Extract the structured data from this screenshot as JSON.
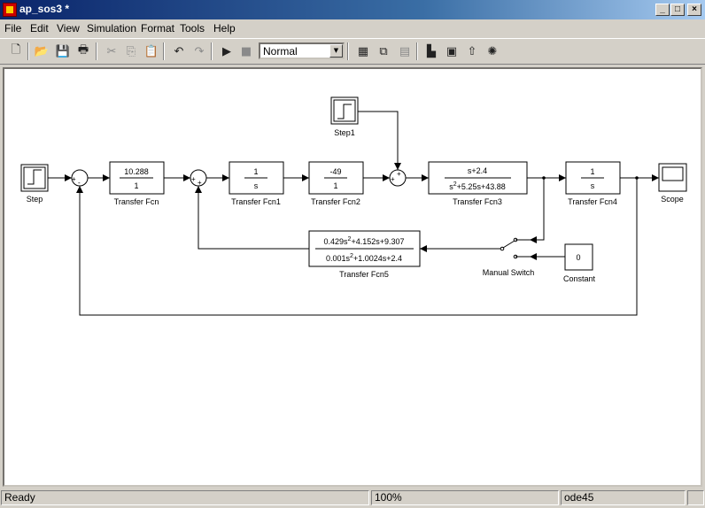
{
  "window": {
    "title": "ap_sos3 *",
    "minimize": "_",
    "maximize": "□",
    "close": "×"
  },
  "menu": [
    "File",
    "Edit",
    "View",
    "Simulation",
    "Format",
    "Tools",
    "Help"
  ],
  "toolbar": {
    "sim_mode": "Normal"
  },
  "model": {
    "blocks": {
      "step": "Step",
      "step1": "Step1",
      "tf": {
        "name": "Transfer Fcn",
        "num": "10.288",
        "den": "1"
      },
      "tf1": {
        "name": "Transfer Fcn1",
        "num": "1",
        "den": "s"
      },
      "tf2": {
        "name": "Transfer Fcn2",
        "num": "-49",
        "den": "1"
      },
      "tf3": {
        "name": "Transfer Fcn3",
        "num": "s+2.4",
        "den_a": "s",
        "den_exp": "2",
        "den_b": "+5.25s+43.88"
      },
      "tf4": {
        "name": "Transfer Fcn4",
        "num": "1",
        "den": "s"
      },
      "tf5": {
        "name": "Transfer Fcn5",
        "num_a": "0.429s",
        "num_exp": "2",
        "num_b": "+4.152s+9.307",
        "den_a": "0.001s",
        "den_exp": "2",
        "den_b": "+1.0024s+2.4"
      },
      "scope": "Scope",
      "manual_switch": "Manual Switch",
      "constant": {
        "name": "Constant",
        "value": "0"
      }
    },
    "signs": {
      "plus": "+",
      "minus": "-"
    }
  },
  "status": {
    "state": "Ready",
    "zoom": "100%",
    "solver": "ode45"
  }
}
